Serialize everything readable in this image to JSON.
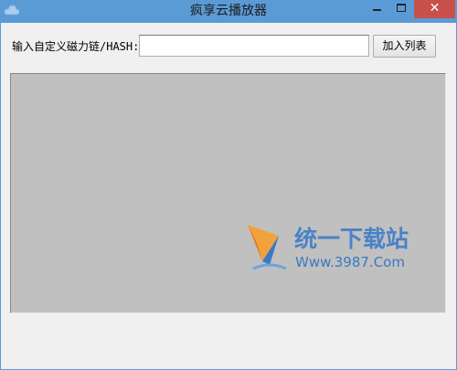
{
  "window": {
    "title": "疯享云播放器",
    "controls": {
      "minimize": "minimize",
      "maximize": "maximize",
      "close": "✕"
    },
    "colors": {
      "titlebar": "#5b9bd5",
      "close": "#c7504a",
      "client": "#f0f0f0",
      "list": "#c0c0c0"
    }
  },
  "toolbar": {
    "magnet_label": "输入自定义磁力链/HASH:",
    "magnet_value": "",
    "magnet_placeholder": "",
    "add_button": "加入列表"
  },
  "watermark": {
    "name": "统一下载站",
    "url": "Www.3987.Com"
  },
  "icons": [
    "cloud-icon",
    "minimize-icon",
    "maximize-icon",
    "close-icon",
    "watermark-logo-icon"
  ]
}
